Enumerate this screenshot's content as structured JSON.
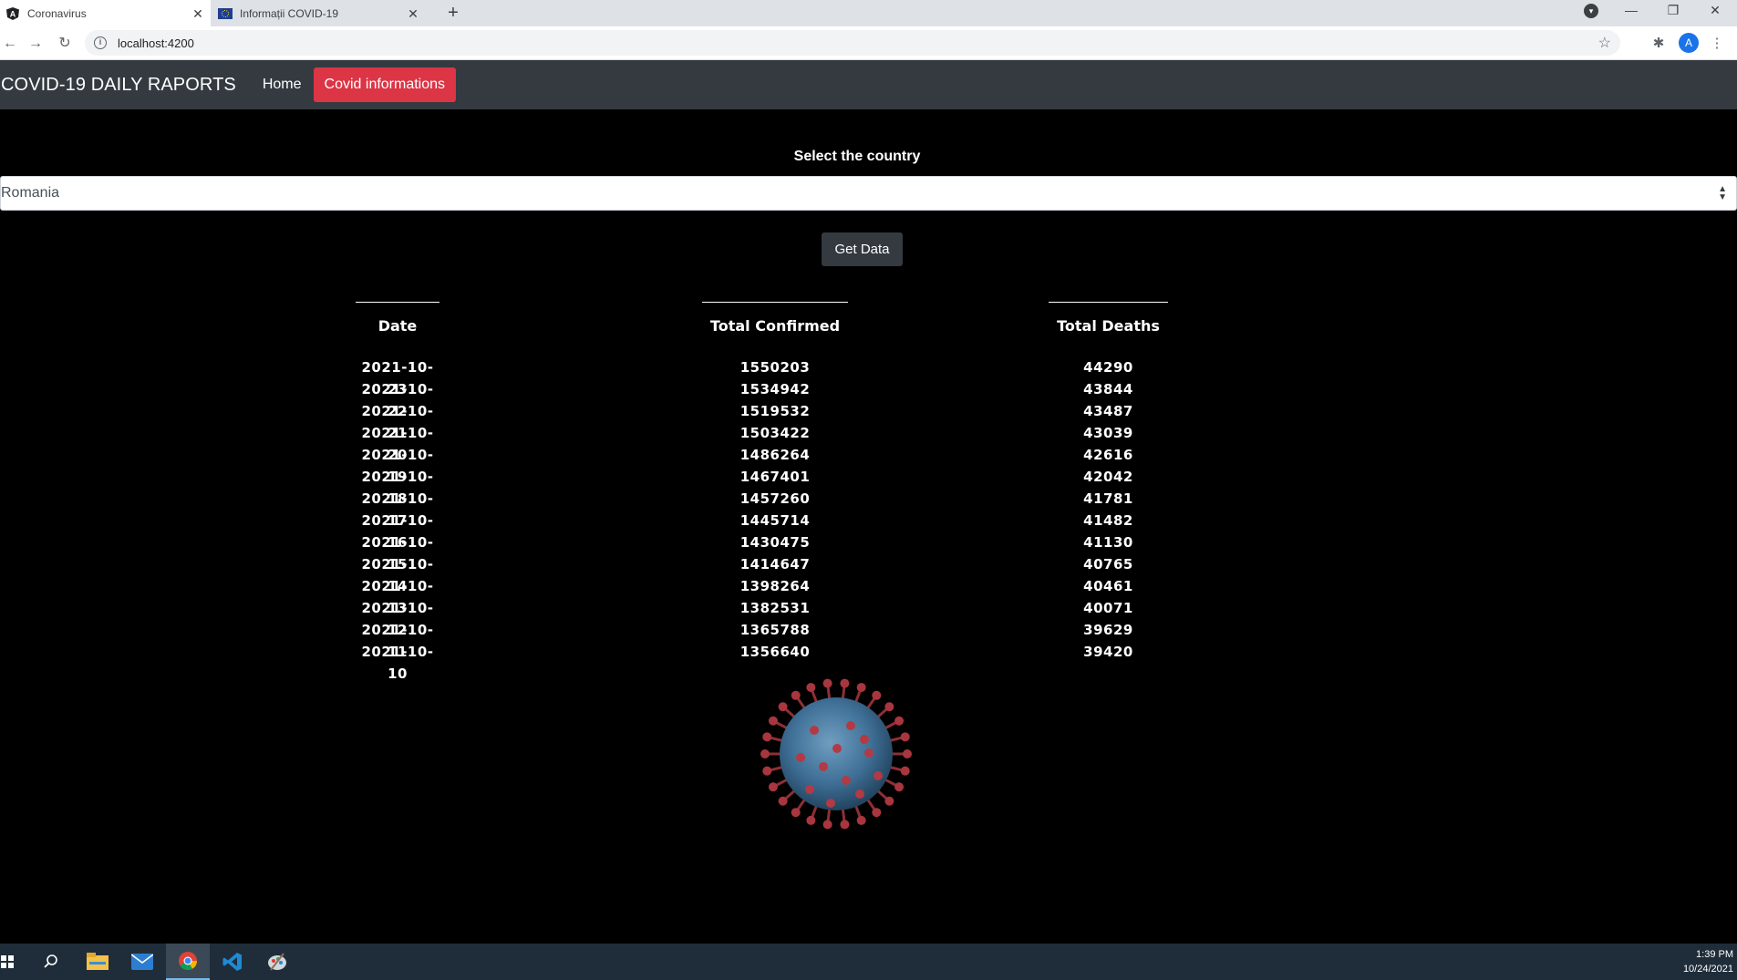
{
  "browser": {
    "tabs": [
      {
        "title": "Coronavirus",
        "favicon": "angular-icon",
        "active": true
      },
      {
        "title": "Informații COVID-19",
        "favicon": "eu-flag-icon",
        "active": false
      }
    ],
    "url": "localhost:4200",
    "profile_initial": "A"
  },
  "navbar": {
    "brand": "COVID-19 DAILY RAPORTS",
    "home_label": "Home",
    "covid_label": "Covid informations",
    "covid_color": "#dc3545",
    "bg_color": "#343a40"
  },
  "country_select": {
    "label": "Select the country",
    "value": "Romania"
  },
  "get_data_button": "Get Data",
  "table": {
    "headers": [
      "Date",
      "Total Confirmed",
      "Total Deaths"
    ],
    "rows": [
      [
        "2021-10-23",
        "1550203",
        "44290"
      ],
      [
        "2021-10-22",
        "1534942",
        "43844"
      ],
      [
        "2021-10-21",
        "1519532",
        "43487"
      ],
      [
        "2021-10-20",
        "1503422",
        "43039"
      ],
      [
        "2021-10-19",
        "1486264",
        "42616"
      ],
      [
        "2021-10-18",
        "1467401",
        "42042"
      ],
      [
        "2021-10-17",
        "1457260",
        "41781"
      ],
      [
        "2021-10-16",
        "1445714",
        "41482"
      ],
      [
        "2021-10-15",
        "1430475",
        "41130"
      ],
      [
        "2021-10-14",
        "1414647",
        "40765"
      ],
      [
        "2021-10-13",
        "1398264",
        "40461"
      ],
      [
        "2021-10-12",
        "1382531",
        "40071"
      ],
      [
        "2021-10-11",
        "1365788",
        "39629"
      ],
      [
        "2021-10-10",
        "1356640",
        "39420"
      ]
    ]
  },
  "taskbar": {
    "time": "1:39 PM",
    "date": "10/24/2021",
    "apps": [
      "windows-start-icon",
      "search-icon",
      "file-explorer-icon",
      "mail-icon",
      "chrome-icon",
      "vscode-icon",
      "paint-icon"
    ]
  }
}
